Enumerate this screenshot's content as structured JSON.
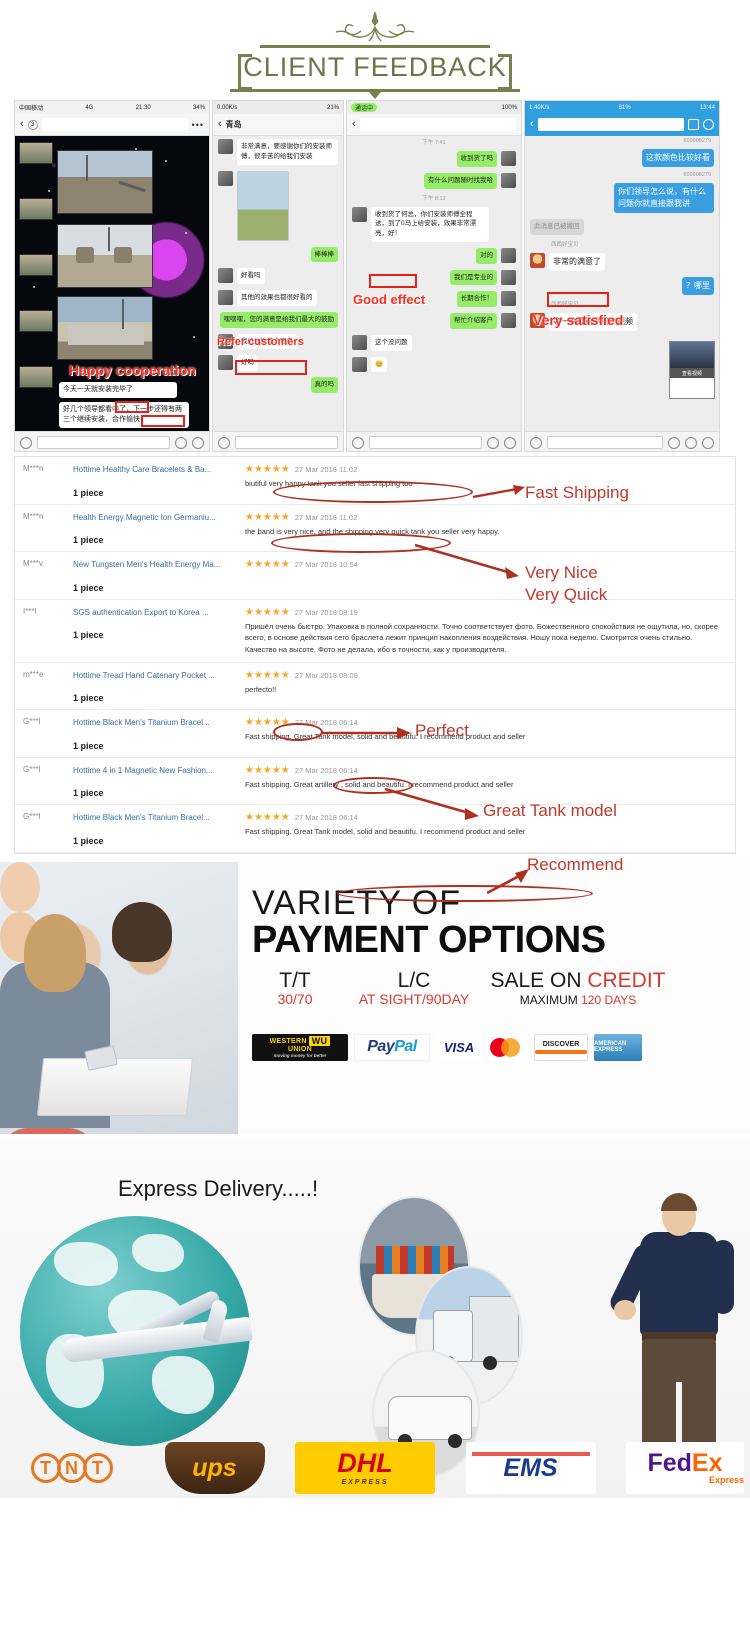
{
  "header": {
    "title": "CLIENT FEEDBACK",
    "ornament_icon": "flourish-ornament"
  },
  "chat_screenshots": [
    {
      "id": "phone-1",
      "status": {
        "carrier": "中国移动",
        "network": "4G",
        "time": "21:30",
        "battery": "34%"
      },
      "nav": {
        "back_icon": "chevron-left-icon",
        "badge": "3",
        "more_icon": "more-dots-icon"
      },
      "annotation": "Happy cooperation",
      "bubbles": [
        {
          "text": "今天一天就安装完毕了"
        },
        {
          "text": "好几个领导都看中了，下一步还得有两三个继续安装，合作愉快"
        }
      ],
      "highlights": [
        "看中了",
        "合作愉快"
      ],
      "footer_icons": [
        "voice-icon",
        "emoji-icon",
        "plus-icon"
      ]
    },
    {
      "id": "phone-2",
      "status": {
        "network": "0.00K/s",
        "battery": "21%"
      },
      "nav": {
        "back_icon": "chevron-left-icon",
        "title": "青岛"
      },
      "annotation": "Refer customers",
      "messages": [
        {
          "side": "left",
          "text": "非常满意，要感谢你们的安装师傅，很辛苦的给我们安装"
        },
        {
          "side": "left",
          "type": "image"
        },
        {
          "side": "right",
          "text": "棒棒棒"
        },
        {
          "side": "left",
          "text": "好看吗"
        },
        {
          "side": "left",
          "text": "其他的效果也都很好看的"
        },
        {
          "side": "right",
          "text": "嘿嘿嘿，您的满意是给我们最大的鼓励"
        },
        {
          "side": "left",
          "text": "我给你推荐个客户"
        },
        {
          "side": "left",
          "text": "好吗"
        },
        {
          "side": "right",
          "text": "真的吗"
        }
      ],
      "highlights": [
        "我给你推荐个客户"
      ]
    },
    {
      "id": "phone-3",
      "status": {
        "call_badge": "通话中",
        "battery": "100%"
      },
      "nav": {
        "back_icon": "chevron-left-icon"
      },
      "annotation": "Good effect",
      "messages": [
        {
          "side": "right",
          "text": "收到货了吗"
        },
        {
          "side": "right",
          "text": "有什么问题随时找我哈"
        },
        {
          "side": "left",
          "text": "收到货了何总，你们安装师傅全程送，到了0马上给安装，效果非常漂亮，好！"
        },
        {
          "side": "right",
          "text": "对的"
        },
        {
          "side": "right",
          "text": "我们是专业的"
        },
        {
          "side": "right",
          "text": "长期合作！"
        },
        {
          "side": "right",
          "text": "帮忙介绍客户"
        },
        {
          "side": "left",
          "text": "这个没问题"
        },
        {
          "side": "left",
          "text": "😊"
        }
      ],
      "highlights": [
        "漂亮，好！"
      ]
    },
    {
      "id": "phone-4",
      "status": {
        "network": "1.40K/s",
        "battery": "61%",
        "time": "13:44"
      },
      "nav": {
        "back_icon": "chevron-left-icon",
        "panel_icon": "panel-icon",
        "profile_icon": "person-icon"
      },
      "annotation": "Very satisfied",
      "messages": [
        {
          "side": "right",
          "text": "这款颜色比较好看",
          "sender": "609908279"
        },
        {
          "side": "right",
          "text": "你们领导怎么说，有什么问题你就直接跟我讲",
          "sender": "609908279"
        },
        {
          "side": "left",
          "type": "gray",
          "text": "此消息已被撤回"
        },
        {
          "side": "left",
          "text": "非常的满意了",
          "sender": "西西好宝贝"
        },
        {
          "side": "right",
          "text": "？哪里",
          "sender": "609908279"
        },
        {
          "side": "left",
          "text": "等一会我给你拍个视频",
          "sender": "西西好宝贝"
        }
      ],
      "highlights": [
        "非常的满意了"
      ],
      "video_card_label": "查看视频"
    }
  ],
  "reviews": {
    "rows": [
      {
        "user": "M***n",
        "product": "Hottime Healthy Care Bracelets & Ba...",
        "qty": "1 piece",
        "stars": "★★★★★",
        "date": "27 Mar 2018 11:02",
        "text": "biutiful very happy tank you seller fast shipping too"
      },
      {
        "user": "M***n",
        "product": "Health Energy Magnetic Ion Germaniu...",
        "qty": "1 piece",
        "stars": "★★★★★",
        "date": "27 Mar 2018 11:02",
        "text": "the band is very nice, and the shipping very quick tank you seller very happy."
      },
      {
        "user": "M***v",
        "product": "New Tungsten Men's Health Energy Ma...",
        "qty": "1 piece",
        "stars": "★★★★★",
        "date": "27 Mar 2018 10:54",
        "text": ""
      },
      {
        "user": "I***l",
        "product": "SGS authentication Export to Korea ...",
        "qty": "1 piece",
        "stars": "★★★★★",
        "date": "27 Mar 2018 08:19",
        "text": "Пришёл очень быстро. Упаковка в полной сохранности. Точно соответствует фото. Божественного спокойствия не ощутила, но, скорее всего, в основе действия сего браслета лежит принцип накопления воздействия. Ношу пока неделю. Смотрится очень стильно. Качество на высоте. Фото не делала, ибо в точности, как у производителя."
      },
      {
        "user": "m***e",
        "product": "Hottime Tread Hand Catenary Pocket ...",
        "qty": "1 piece",
        "stars": "★★★★★",
        "date": "27 Mar 2018 08:09",
        "text": "perfecto!!"
      },
      {
        "user": "G***l",
        "product": "Hottime Black Men's Titanium Bracel...",
        "qty": "1 piece",
        "stars": "★★★★★",
        "date": "27 Mar 2018 06:14",
        "text": "Fast shipping. Great Tank model, solid and beautifu. I recommend product and seller"
      },
      {
        "user": "G***l",
        "product": "Hottime 4 in 1 Magnetic New Fashion...",
        "qty": "1 piece",
        "stars": "★★★★★",
        "date": "27 Mar 2018 06:14",
        "text": "Fast shipping. Great artillery , solid and beautifu. I recommend product and seller"
      },
      {
        "user": "G***l",
        "product": "Hottime Black Men's Titanium Bracel...",
        "qty": "1 piece",
        "stars": "★★★★★",
        "date": "27 Mar 2018 06:14",
        "text": "Fast shipping. Great Tank model, solid and beautifu. I recommend product and seller"
      }
    ],
    "annotations": [
      {
        "label": "Fast Shipping"
      },
      {
        "label": "Very Nice"
      },
      {
        "label": "Very Quick"
      },
      {
        "label": "Perfect"
      },
      {
        "label": "Great Tank model"
      },
      {
        "label": "Recommend"
      }
    ],
    "annotation_color": "#c0392b"
  },
  "payment": {
    "line1": "VARIETY OF",
    "line2": "PAYMENT OPTIONS",
    "terms": [
      {
        "top": "T/T",
        "bottom": "30/70"
      },
      {
        "top": "L/C",
        "bottom": "AT SIGHT/90DAY"
      }
    ],
    "credit": {
      "sale": "SALE ON ",
      "credit": "CREDIT",
      "maximum": "MAXIMUM ",
      "days": "120 DAYS"
    },
    "logos": [
      {
        "name": "western-union-logo",
        "l1": "WESTERN",
        "l2": "UNION",
        "mark": "WU",
        "tag": "moving money for better"
      },
      {
        "name": "paypal-logo",
        "a": "Pay",
        "b": "Pal"
      },
      {
        "name": "visa-logo",
        "text": "VISA"
      },
      {
        "name": "mastercard-logo",
        "text": "MasterCard"
      },
      {
        "name": "discover-logo",
        "text": "DISCOVER"
      },
      {
        "name": "amex-logo",
        "text": "AMERICAN EXPRESS"
      }
    ]
  },
  "delivery": {
    "title": "Express Delivery.....!",
    "carriers": [
      {
        "name": "tnt-logo",
        "text": "TNT"
      },
      {
        "name": "ups-logo",
        "text": "ups"
      },
      {
        "name": "dhl-logo",
        "text": "DHL",
        "sub": "EXPRESS"
      },
      {
        "name": "ems-logo",
        "text": "EMS"
      },
      {
        "name": "fedex-logo",
        "fed": "Fed",
        "ex": "Ex",
        "sub": "Express"
      }
    ]
  },
  "colors": {
    "header_olive": "#7a7f4e",
    "annotation_red": "#c0392b",
    "wechat_green": "#95ec69",
    "qq_blue": "#3a9ee0",
    "link_blue": "#3a6ea5",
    "star_gold": "#f5a623"
  }
}
